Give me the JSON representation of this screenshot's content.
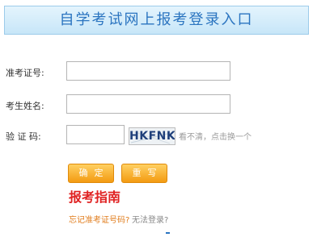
{
  "header": {
    "title": "自学考试网上报考登录入口"
  },
  "form": {
    "exam_id": {
      "label": "准考证号:",
      "value": ""
    },
    "name": {
      "label": "考生姓名:",
      "value": ""
    },
    "captcha": {
      "label": "验 证 码:",
      "value": "",
      "image_text": "HKFNK",
      "refresh_text": "看不清，点击换一个"
    }
  },
  "buttons": {
    "confirm": "确定",
    "reset": "重写"
  },
  "guide": {
    "title": "报考指南"
  },
  "links": {
    "forgot": "忘记准考证号码?",
    "cannot_login": "无法登录?"
  },
  "colors": {
    "header_text": "#2a74c0",
    "button": "#f39b12",
    "guide": "#e02222",
    "forgot_link": "#e07b1a"
  }
}
